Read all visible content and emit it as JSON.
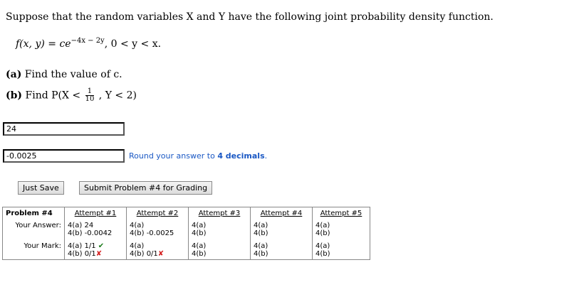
{
  "problem": {
    "intro": "Suppose that the random variables X and Y have the following joint probability density function.",
    "formula_lhs": "f(x, y) = ce",
    "formula_exp": "−4x − 2y",
    "formula_tail": ",   0 < y < x.",
    "part_a_label": "(a)",
    "part_a_text": "Find the value of c.",
    "part_b_label": "(b)",
    "part_b_prefix": "Find P(X <",
    "part_b_frac_num": "1",
    "part_b_frac_den": "10",
    "part_b_suffix": ", Y < 2)"
  },
  "answers": {
    "a_value": "24",
    "b_value": "-0.0025",
    "hint_prefix": "Round your answer to ",
    "hint_bold": "4 decimals",
    "hint_suffix": "."
  },
  "buttons": {
    "just_save": "Just Save",
    "submit": "Submit Problem #4 for Grading"
  },
  "attempts": {
    "header": "Problem #4",
    "columns": [
      "Attempt #1",
      "Attempt #2",
      "Attempt #3",
      "Attempt #4",
      "Attempt #5"
    ],
    "answer_label": "Your Answer:",
    "mark_label": "Your Mark:",
    "answers": [
      [
        "4(a) 24",
        "4(b) -0.0042"
      ],
      [
        "4(a)",
        "4(b) -0.0025"
      ],
      [
        "4(a)",
        "4(b)"
      ],
      [
        "4(a)",
        "4(b)"
      ],
      [
        "4(a)",
        "4(b)"
      ]
    ],
    "marks": [
      [
        {
          "text": "4(a) 1/1",
          "icon": "check"
        },
        {
          "text": "4(b) 0/1",
          "icon": "cross"
        }
      ],
      [
        {
          "text": "4(a)",
          "icon": ""
        },
        {
          "text": "4(b) 0/1",
          "icon": "cross"
        }
      ],
      [
        {
          "text": "4(a)",
          "icon": ""
        },
        {
          "text": "4(b)",
          "icon": ""
        }
      ],
      [
        {
          "text": "4(a)",
          "icon": ""
        },
        {
          "text": "4(b)",
          "icon": ""
        }
      ],
      [
        {
          "text": "4(a)",
          "icon": ""
        },
        {
          "text": "4(b)",
          "icon": ""
        }
      ]
    ],
    "check_glyph": "✔",
    "cross_glyph": "✘",
    "colors": {
      "correct": "#1a7a1a",
      "incorrect": "#d42020",
      "hint": "#1a58c4"
    }
  }
}
